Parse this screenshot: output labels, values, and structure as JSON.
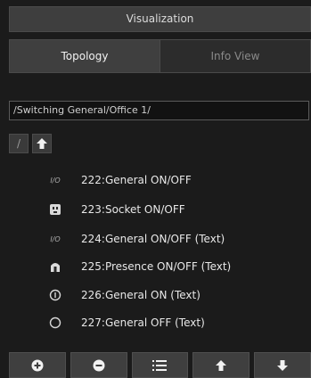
{
  "header": {
    "title": "Visualization"
  },
  "tabs": [
    {
      "label": "Topology",
      "active": true
    },
    {
      "label": "Info View",
      "active": false
    }
  ],
  "path": {
    "value": "/Switching General/Office 1/"
  },
  "nav": {
    "root_label": "/"
  },
  "items": [
    {
      "icon": "io-text-icon",
      "icon_text": "I/O",
      "label": "222:General ON/OFF"
    },
    {
      "icon": "socket-icon",
      "label": "223:Socket ON/OFF"
    },
    {
      "icon": "io-text-icon",
      "icon_text": "I/O",
      "label": "224:General ON/OFF (Text)"
    },
    {
      "icon": "presence-icon",
      "label": "225:Presence ON/OFF (Text)"
    },
    {
      "icon": "on-circle-icon",
      "label": "226:General ON (Text)"
    },
    {
      "icon": "off-circle-icon",
      "label": "227:General OFF (Text)"
    }
  ],
  "toolbar": {
    "buttons": [
      "add-icon",
      "remove-icon",
      "list-icon",
      "move-up-icon",
      "move-down-icon"
    ]
  },
  "colors": {
    "background": "#1b1b1b",
    "panel": "#3e3e3e",
    "text": "#e6e6e6"
  }
}
